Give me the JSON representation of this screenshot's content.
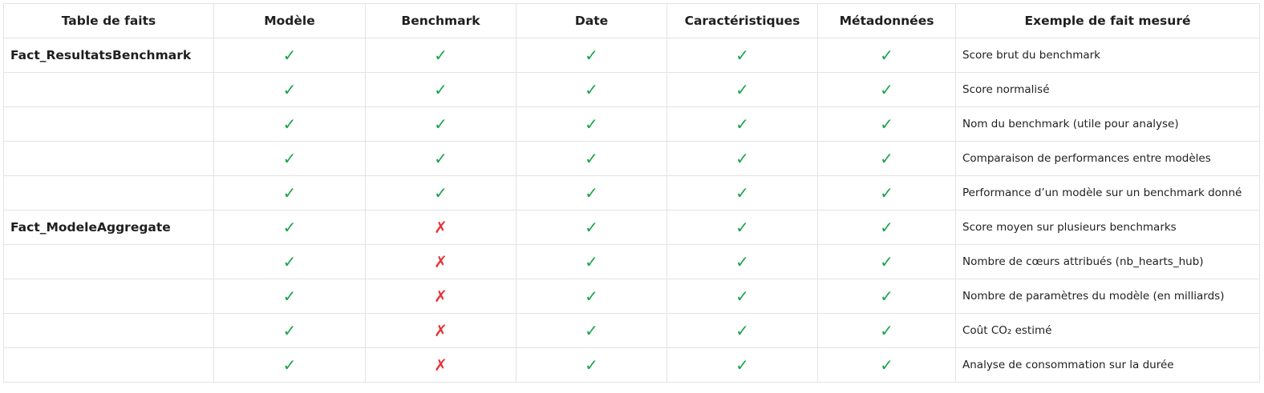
{
  "headers": [
    "Table de faits",
    "Modèle",
    "Benchmark",
    "Date",
    "Caractéristiques",
    "Métadonnées",
    "Exemple de fait mesuré"
  ],
  "icons": {
    "yes": {
      "glyph": "✓",
      "name": "check-icon",
      "color": "#1aa34a"
    },
    "no": {
      "glyph": "✗",
      "name": "cross-icon",
      "color": "#e5353b"
    }
  },
  "rows": [
    {
      "table": "Fact_ResultatsBenchmark",
      "marks": [
        "yes",
        "yes",
        "yes",
        "yes",
        "yes"
      ],
      "example": "Score brut du benchmark"
    },
    {
      "table": "",
      "marks": [
        "yes",
        "yes",
        "yes",
        "yes",
        "yes"
      ],
      "example": "Score normalisé"
    },
    {
      "table": "",
      "marks": [
        "yes",
        "yes",
        "yes",
        "yes",
        "yes"
      ],
      "example": "Nom du benchmark (utile pour analyse)"
    },
    {
      "table": "",
      "marks": [
        "yes",
        "yes",
        "yes",
        "yes",
        "yes"
      ],
      "example": "Comparaison de performances entre modèles"
    },
    {
      "table": "",
      "marks": [
        "yes",
        "yes",
        "yes",
        "yes",
        "yes"
      ],
      "example": "Performance d’un modèle sur un benchmark donné"
    },
    {
      "table": "Fact_ModeleAggregate",
      "marks": [
        "yes",
        "no",
        "yes",
        "yes",
        "yes"
      ],
      "example": "Score moyen sur plusieurs benchmarks"
    },
    {
      "table": "",
      "marks": [
        "yes",
        "no",
        "yes",
        "yes",
        "yes"
      ],
      "example": "Nombre de cœurs attribués (nb_hearts_hub)"
    },
    {
      "table": "",
      "marks": [
        "yes",
        "no",
        "yes",
        "yes",
        "yes"
      ],
      "example": "Nombre de paramètres du modèle (en milliards)"
    },
    {
      "table": "",
      "marks": [
        "yes",
        "no",
        "yes",
        "yes",
        "yes"
      ],
      "example": "Coût CO₂ estimé"
    },
    {
      "table": "",
      "marks": [
        "yes",
        "no",
        "yes",
        "yes",
        "yes"
      ],
      "example": "Analyse de consommation sur la durée"
    }
  ]
}
